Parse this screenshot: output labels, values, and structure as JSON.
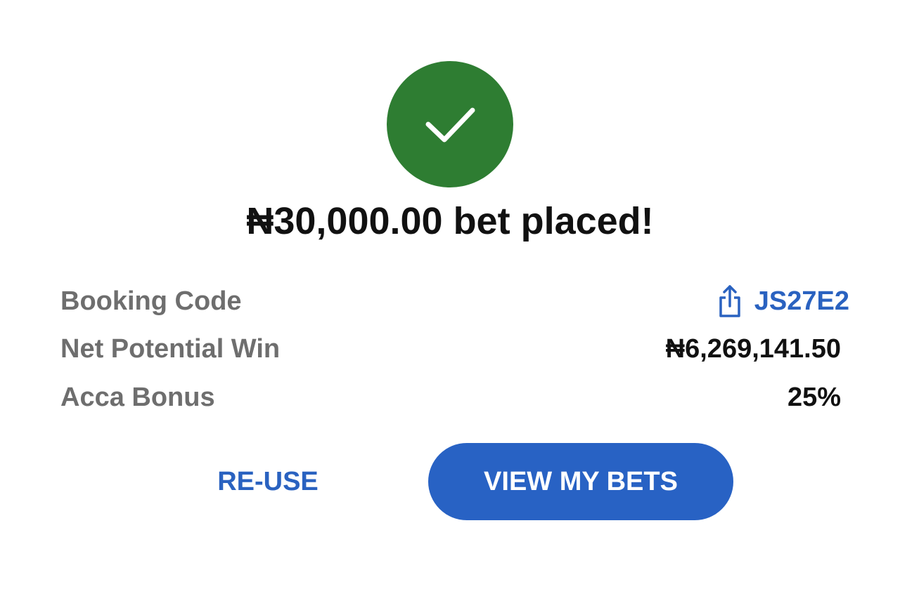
{
  "success": {
    "icon": "checkmark-icon",
    "color": "#2e7d32",
    "headline": "₦30,000.00 bet placed!"
  },
  "details": {
    "booking_code": {
      "label": "Booking Code",
      "value": "JS27E2",
      "icon": "share-icon"
    },
    "net_potential_win": {
      "label": "Net Potential Win",
      "value": "₦6,269,141.50"
    },
    "acca_bonus": {
      "label": "Acca Bonus",
      "value": "25%"
    }
  },
  "actions": {
    "reuse_label": "RE-USE",
    "view_bets_label": "VIEW MY BETS"
  },
  "colors": {
    "accent": "#2a62c0",
    "success": "#2e7d32"
  }
}
